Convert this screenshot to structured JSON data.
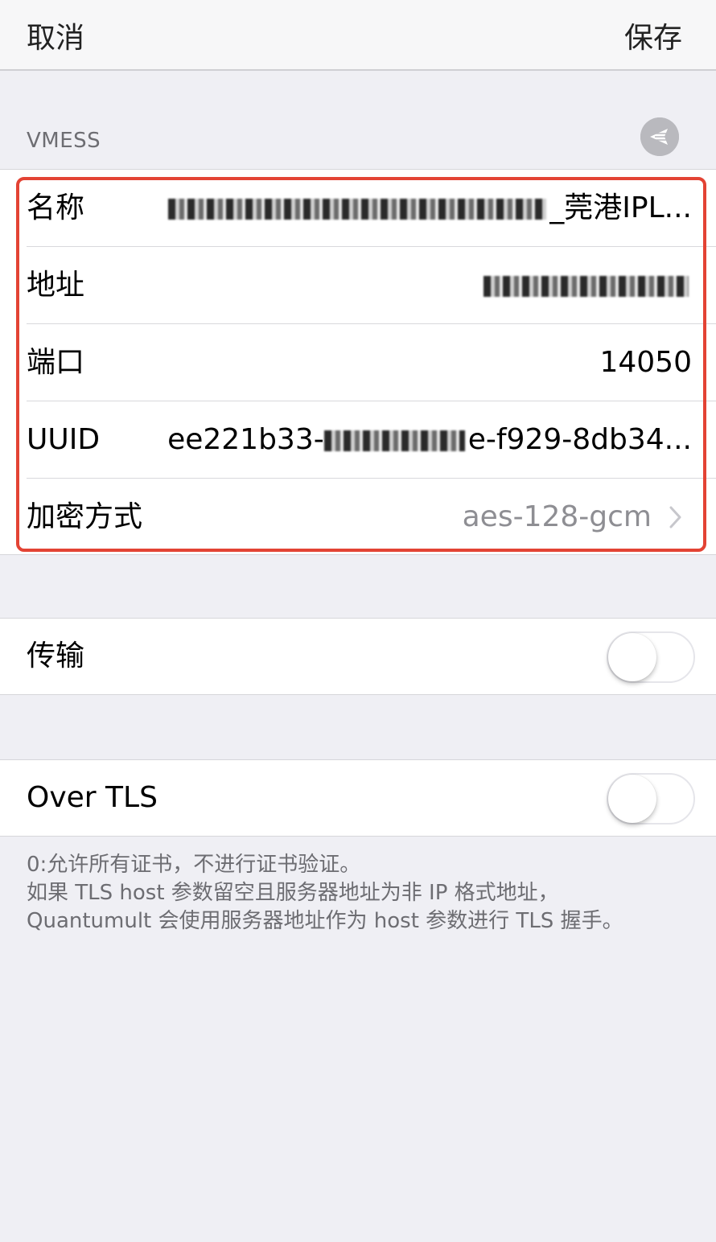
{
  "navbar": {
    "cancel_label": "取消",
    "save_label": "保存"
  },
  "section": {
    "header": "VMESS",
    "icon": "share-arrows-icon"
  },
  "fields": [
    {
      "label": "名称",
      "value_suffix": "_莞港IPL..."
    },
    {
      "label": "地址",
      "value_suffix": ""
    },
    {
      "label": "端口",
      "value": "14050"
    },
    {
      "label": "UUID",
      "value_prefix": "ee221b33-",
      "value_suffix": "e-f929-8db34..."
    },
    {
      "label": "加密方式",
      "value": "aes-128-gcm"
    }
  ],
  "transport": {
    "label": "传输",
    "enabled": false
  },
  "tls": {
    "label": "Over TLS",
    "enabled": false
  },
  "footer": {
    "line1": "0:允许所有证书，不进行证书验证。",
    "line2": "如果 TLS host 参数留空且服务器地址为非 IP 格式地址，",
    "line3": "Quantumult 会使用服务器地址作为 host 参数进行 TLS 握手。"
  },
  "colors": {
    "highlight": "#e34334",
    "background": "#efeff4"
  }
}
